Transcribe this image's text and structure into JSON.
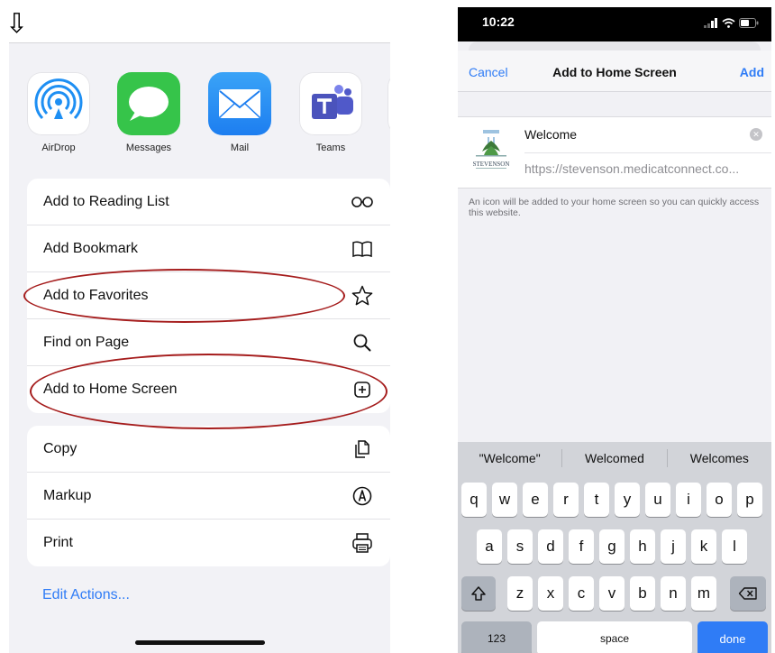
{
  "annotation": {
    "arrow_glyph": "⇩"
  },
  "share_sheet": {
    "apps": [
      {
        "name": "AirDrop",
        "icon": "airdrop-icon"
      },
      {
        "name": "Messages",
        "icon": "messages-icon"
      },
      {
        "name": "Mail",
        "icon": "mail-icon"
      },
      {
        "name": "Teams",
        "icon": "teams-icon"
      },
      {
        "name": "",
        "icon": "partial-app-icon"
      }
    ],
    "actions_group1": [
      {
        "label": "Add to Reading List",
        "icon": "reading-list-icon"
      },
      {
        "label": "Add Bookmark",
        "icon": "bookmark-book-icon"
      },
      {
        "label": "Add to Favorites",
        "icon": "star-icon"
      },
      {
        "label": "Find on Page",
        "icon": "magnifier-icon"
      },
      {
        "label": "Add to Home Screen",
        "icon": "plus-square-icon"
      }
    ],
    "actions_group2": [
      {
        "label": "Copy",
        "icon": "copy-icon"
      },
      {
        "label": "Markup",
        "icon": "markup-icon"
      },
      {
        "label": "Print",
        "icon": "printer-icon"
      }
    ],
    "edit_actions": "Edit Actions..."
  },
  "home_screen": {
    "status_time": "10:22",
    "nav": {
      "cancel": "Cancel",
      "title": "Add to Home Screen",
      "add": "Add"
    },
    "entry": {
      "name_value": "Welcome",
      "url": "https://stevenson.medicatconnect.co...",
      "logo_text": "STEVENSON"
    },
    "hint": "An icon will be added to your home screen so you can quickly access this website.",
    "keyboard": {
      "suggestions": [
        "\"Welcome\"",
        "Welcomed",
        "Welcomes"
      ],
      "row1": [
        "q",
        "w",
        "e",
        "r",
        "t",
        "y",
        "u",
        "i",
        "o",
        "p"
      ],
      "row2": [
        "a",
        "s",
        "d",
        "f",
        "g",
        "h",
        "j",
        "k",
        "l"
      ],
      "row3": [
        "z",
        "x",
        "c",
        "v",
        "b",
        "n",
        "m"
      ],
      "numbers": "123",
      "space": "space",
      "done": "done"
    }
  },
  "colors": {
    "link_blue": "#2f7cf6",
    "annotation_red": "#a51c1c",
    "sheet_bg": "#f2f2f6"
  }
}
